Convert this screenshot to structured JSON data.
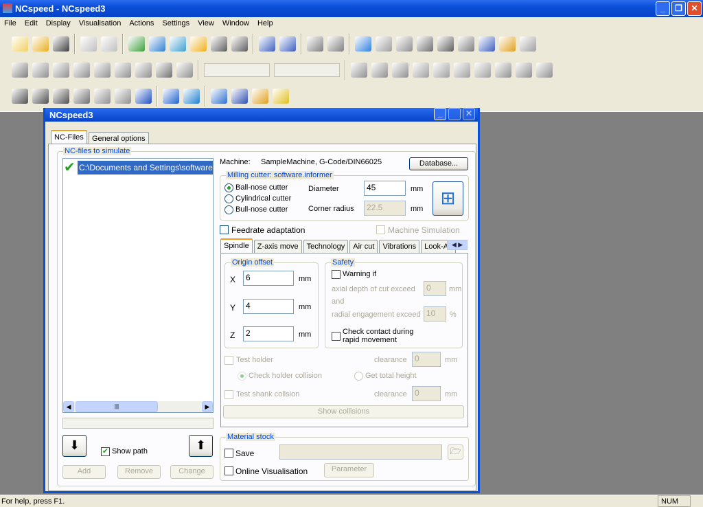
{
  "app": {
    "title": "NCspeed - NCspeed3"
  },
  "menu": [
    "File",
    "Edit",
    "Display",
    "Visualisation",
    "Actions",
    "Settings",
    "View",
    "Window",
    "Help"
  ],
  "toolbar_rows": [
    [
      "new-file-icon:#f0d060",
      "open-folder-icon:#e8b020",
      "save-icon:#404040",
      "|",
      "copy-icon:#c0c0c0",
      "paste-icon:#c0c0c0",
      "|",
      "import-icon:#40a040",
      "convert-icon:#3080d0",
      "transfer-icon:#40a0d0",
      "merge-icon:#f0b020",
      "wand-icon:#606060",
      "tool-icon:#606060",
      "|",
      "simulate-icon:#4060c0",
      "edit-icon:#4060c0",
      "|",
      "stock-icon:#808080",
      "stock2-icon:#808080",
      "|",
      "surface-icon:#3080e0",
      "surface2-icon:#a0a0a0",
      "surface3-icon:#909090",
      "surface4-icon:#707070",
      "surface5-icon:#606060",
      "surface6-icon:#808080",
      "layers-icon:#4060c0",
      "colormap-icon:#e0a020",
      "diff-icon:#a0a0a0"
    ],
    [
      "cube-icon:#808080",
      "axis-zx-icon:#909090",
      "axis-yx-icon:#909090",
      "axis-zy-icon:#909090",
      "wire-cube-icon:#909090",
      "section-icon:#909090",
      "section2-icon:#909090",
      "surface-view-icon:#707070",
      "hand-icon:#909090",
      "|",
      "combo",
      "combo",
      "|",
      "zoom-icon:#909090",
      "pointer-icon:#909090",
      "rotate-icon:#909090",
      "first-icon:#a0a0a0",
      "prev-icon:#a0a0a0",
      "play-icon:#a0a0a0",
      "last-icon:#a0a0a0",
      "camera-icon:#909090",
      "probe-icon:#909090",
      "grid-icon:#909090"
    ],
    [
      "back-icon:#505050",
      "forward-icon:#505050",
      "shuffle-icon:#505050",
      "cog-icon:#707070",
      "box-icon:#909090",
      "print-icon:#909090",
      "font-icon:#2050c0",
      "|",
      "help-icon:#2060d0",
      "info-icon:#2080d0",
      "|",
      "checklist-icon:#3070d0",
      "report-icon:#3050b0",
      "machine-icon:#e0a020",
      "collision-icon:#e0c020"
    ]
  ],
  "status": {
    "text": "For help, press F1.",
    "num": "NUM"
  },
  "dialog": {
    "title": "NCspeed3",
    "tabs": [
      "NC-Files",
      "General options"
    ],
    "nc_group": "NC-files to simulate",
    "files": [
      "C:\\Documents and Settings\\software.info"
    ],
    "scroll_grip": "|||",
    "show_path": "Show path",
    "add": "Add",
    "remove": "Remove",
    "change": "Change",
    "machine_label": "Machine:",
    "machine_value": "SampleMachine, G-Code/DIN66025",
    "database": "Database...",
    "cutter_group": "Milling cutter: software.informer",
    "cutters": [
      "Ball-nose cutter",
      "Cylindrical cutter",
      "Bull-nose cutter"
    ],
    "diameter_label": "Diameter",
    "diameter": "45",
    "corner_label": "Corner radius",
    "corner": "22.5",
    "mm": "mm",
    "feedrate": "Feedrate adaptation",
    "machine_sim": "Machine Simulation",
    "subtabs": [
      "Spindle",
      "Z-axis move",
      "Technology",
      "Air cut",
      "Vibrations",
      "Look-Ah"
    ],
    "origin_group": "Origin offset",
    "x_label": "X",
    "x": "6",
    "y_label": "Y",
    "y": "4",
    "z_label": "Z",
    "z": "2",
    "safety_group": "Safety",
    "warning_if": "Warning if",
    "axial": "axial depth of cut exceed",
    "axial_val": "0",
    "and": "and",
    "radial": "radial engagement exceed",
    "radial_val": "10",
    "pct": "%",
    "check_contact": "Check contact during rapid movement",
    "test_holder": "Test holder",
    "clearance": "clearance",
    "holder_clear": "0",
    "check_holder": "Check holder collision",
    "total_height": "Get total height",
    "test_shank": "Test shank collsion",
    "shank_clear": "0",
    "show_collisions": "Show collisions",
    "stock_group": "Material stock",
    "save": "Save",
    "save_path": "",
    "online": "Online Visualisation",
    "parameter": "Parameter"
  }
}
